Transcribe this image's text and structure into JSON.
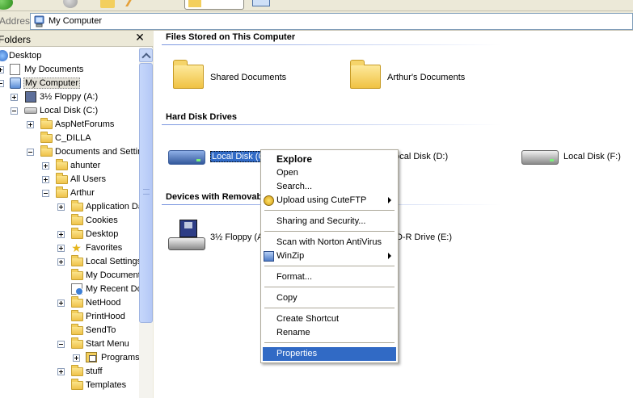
{
  "address": {
    "label": "Address",
    "value": "My Computer"
  },
  "folders_pane": {
    "title": "Folders",
    "close_label": "✕",
    "tree": [
      {
        "label": "Desktop",
        "icon": "desktop-icon"
      },
      {
        "label": "My Documents",
        "icon": "my-documents-icon"
      },
      {
        "label": "My Computer",
        "icon": "my-computer-icon"
      },
      {
        "label": "3½ Floppy (A:)",
        "icon": "floppy-icon"
      },
      {
        "label": "Local Disk (C:)",
        "icon": "drive-icon"
      },
      {
        "label": "AspNetForums",
        "icon": "folder-icon"
      },
      {
        "label": "C_DILLA",
        "icon": "folder-icon"
      },
      {
        "label": "Documents and Settings",
        "icon": "folder-icon"
      },
      {
        "label": "ahunter",
        "icon": "folder-icon"
      },
      {
        "label": "All Users",
        "icon": "folder-icon"
      },
      {
        "label": "Arthur",
        "icon": "folder-icon"
      },
      {
        "label": "Application Data",
        "icon": "folder-icon"
      },
      {
        "label": "Cookies",
        "icon": "folder-icon"
      },
      {
        "label": "Desktop",
        "icon": "folder-icon"
      },
      {
        "label": "Favorites",
        "icon": "favorites-icon"
      },
      {
        "label": "Local Settings",
        "icon": "folder-icon"
      },
      {
        "label": "My Documents",
        "icon": "folder-icon"
      },
      {
        "label": "My Recent Documents",
        "icon": "recent-documents-icon"
      },
      {
        "label": "NetHood",
        "icon": "folder-icon"
      },
      {
        "label": "PrintHood",
        "icon": "folder-icon"
      },
      {
        "label": "SendTo",
        "icon": "folder-icon"
      },
      {
        "label": "Start Menu",
        "icon": "folder-icon"
      },
      {
        "label": "Programs",
        "icon": "programs-folder-icon"
      },
      {
        "label": "stuff",
        "icon": "folder-icon"
      },
      {
        "label": "Templates",
        "icon": "folder-icon"
      }
    ]
  },
  "groups": {
    "files_stored": {
      "title": "Files Stored on This Computer",
      "items": [
        {
          "label": "Shared Documents"
        },
        {
          "label": "Arthur's Documents"
        }
      ]
    },
    "hard_disks": {
      "title": "Hard Disk Drives",
      "items": [
        {
          "label": "Local Disk (C:)"
        },
        {
          "label": "Local Disk (D:)"
        },
        {
          "label": "Local Disk (F:)"
        }
      ]
    },
    "removable": {
      "title": "Devices with Removable Storage",
      "items": [
        {
          "label": "3½ Floppy (A:)"
        },
        {
          "label": "CD-R Drive (E:)"
        }
      ]
    }
  },
  "context_menu": {
    "items": [
      {
        "label": "Explore"
      },
      {
        "label": "Open"
      },
      {
        "label": "Search..."
      },
      {
        "label": "Upload using CuteFTP"
      },
      {
        "label": "Sharing and Security..."
      },
      {
        "label": "Scan with Norton AntiVirus"
      },
      {
        "label": "WinZip"
      },
      {
        "label": "Format..."
      },
      {
        "label": "Copy"
      },
      {
        "label": "Create Shortcut"
      },
      {
        "label": "Rename"
      },
      {
        "label": "Properties"
      }
    ]
  },
  "colors": {
    "selection": "#316ac5",
    "group_line": "#7a96df",
    "window_bg": "#ece9d8"
  }
}
